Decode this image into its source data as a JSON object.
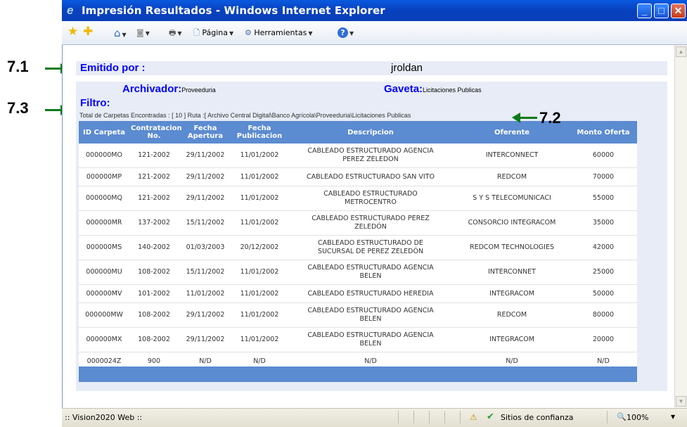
{
  "annotations": {
    "a1": "7.1",
    "a2": "7.2",
    "a3": "7.3"
  },
  "window": {
    "title": "Impresión Resultados - Windows Internet Explorer"
  },
  "toolbar": {
    "page_label": "Página",
    "tools_label": "Herramientas"
  },
  "header": {
    "emitido_label": "Emitido por :",
    "user": "jroldan"
  },
  "filters": {
    "archivador_label": "Archivador:",
    "archivador_value": "Proveeduria",
    "gaveta_label": "Gaveta:",
    "gaveta_value": "Licitaciones Publicas",
    "filtro_label": "Filtro:"
  },
  "ruta": "Total de Carpetas Encontradas : [ 10 ] Ruta :[ Archivo Central Digital\\Banco Agrícola\\Proveeduria\\Licitaciones Publicas",
  "table": {
    "headers": [
      "ID Carpeta",
      "Contratacion No.",
      "Fecha Apertura",
      "Fecha Publicacion",
      "Descripcion",
      "Oferente",
      "Monto Oferta"
    ],
    "rows": [
      [
        "000000MO",
        "121-2002",
        "29/11/2002",
        "11/01/2002",
        "CABLEADO ESTRUCTURADO AGENCIA PEREZ ZELEDON",
        "INTERCONNECT",
        "60000"
      ],
      [
        "000000MP",
        "121-2002",
        "29/11/2002",
        "11/01/2002",
        "CABLEADO ESTRUCTURADO SAN VITO",
        "REDCOM",
        "70000"
      ],
      [
        "000000MQ",
        "121-2002",
        "29/11/2002",
        "11/01/2002",
        "CABLEADO ESTRUCTURADO METROCENTRO",
        "S Y S TELECOMUNICACI",
        "55000"
      ],
      [
        "000000MR",
        "137-2002",
        "15/11/2002",
        "11/01/2002",
        "CABLEADO ESTRUCTURADO PEREZ ZELEDÓN",
        "CONSORCIO INTEGRACOM",
        "35000"
      ],
      [
        "000000MS",
        "140-2002",
        "01/03/2003",
        "20/12/2002",
        "CABLEADO ESTRUCTURADO DE SUCURSAL DE PEREZ ZELEDÓN",
        "REDCOM TECHNOLOGIES",
        "42000"
      ],
      [
        "000000MU",
        "108-2002",
        "15/11/2002",
        "11/01/2002",
        "CABLEADO ESTRUCTURADO AGENCIA BELEN",
        "INTERCONNET",
        "25000"
      ],
      [
        "000000MV",
        "101-2002",
        "11/01/2002",
        "11/01/2002",
        "CABLEADO ESTRUCTURADO HEREDIA",
        "INTEGRACOM",
        "50000"
      ],
      [
        "000000MW",
        "108-2002",
        "29/11/2002",
        "11/01/2002",
        "CABLEADO ESTRUCTURADO AGENCIA BELEN",
        "REDCOM",
        "80000"
      ],
      [
        "000000MX",
        "108-2002",
        "29/11/2002",
        "11/01/2002",
        "CABLEADO ESTRUCTURADO AGENCIA BELEN",
        "INTEGRACOM",
        "20000"
      ],
      [
        "0000024Z",
        "900",
        "N/D",
        "N/D",
        "N/D",
        "N/D",
        "N/D"
      ]
    ]
  },
  "status": {
    "left": ":: Vision2020 Web ::",
    "zone": "Sitios de confianza",
    "zoom": "100%"
  }
}
